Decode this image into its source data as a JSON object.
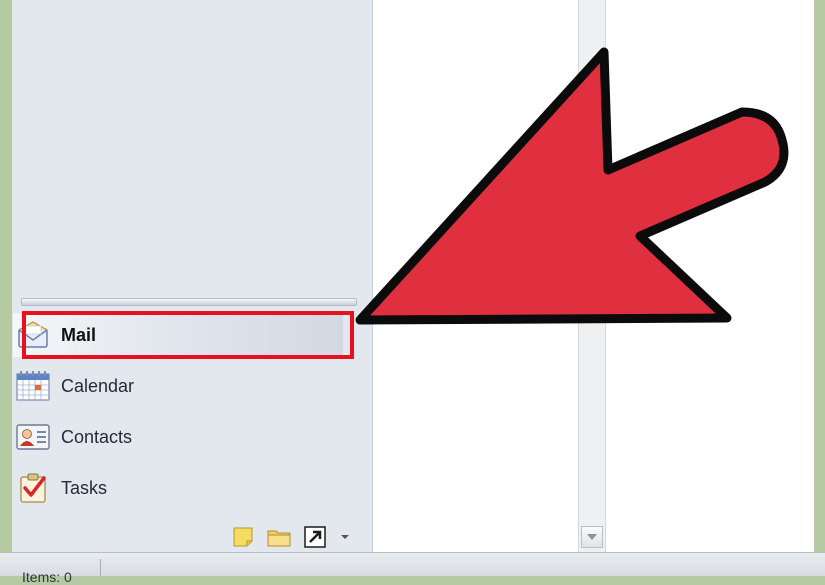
{
  "nav_pane": {
    "items": [
      {
        "label": "Mail",
        "icon": "mail-icon",
        "selected": true
      },
      {
        "label": "Calendar",
        "icon": "calendar-icon",
        "selected": false
      },
      {
        "label": "Contacts",
        "icon": "contacts-icon",
        "selected": false
      },
      {
        "label": "Tasks",
        "icon": "tasks-icon",
        "selected": false
      }
    ],
    "mini_toolbar": [
      "notes-icon",
      "folder-icon",
      "shortcuts-icon",
      "configure-buttons-chevron-icon"
    ]
  },
  "status_bar": {
    "items_text": "Items: 0"
  },
  "annotation": {
    "arrow_color": "#e0303f",
    "highlight_color": "#e8101f"
  }
}
